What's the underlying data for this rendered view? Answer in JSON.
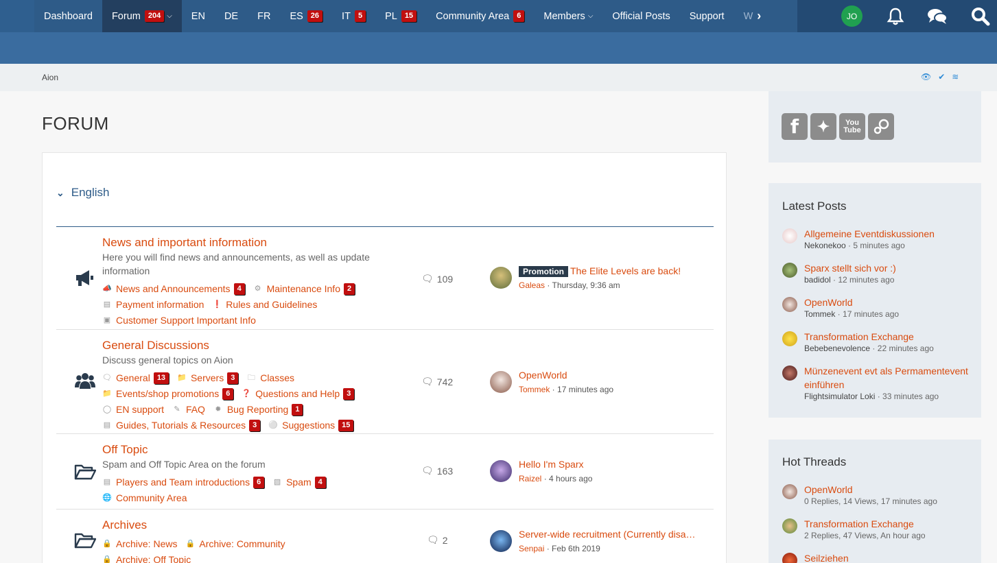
{
  "nav": {
    "items": [
      {
        "label": "Dashboard"
      },
      {
        "label": "Forum",
        "badge": "204"
      },
      {
        "label": "EN"
      },
      {
        "label": "DE"
      },
      {
        "label": "FR"
      },
      {
        "label": "ES",
        "badge": "26"
      },
      {
        "label": "IT",
        "badge": "5"
      },
      {
        "label": "PL",
        "badge": "15"
      },
      {
        "label": "Community Area",
        "badge": "6"
      },
      {
        "label": "Members"
      },
      {
        "label": "Official Posts"
      },
      {
        "label": "Support"
      },
      {
        "label": "W"
      }
    ],
    "user_initials": "JO",
    "icons": [
      "bell-icon",
      "chat-bubbles-icon",
      "search-icon"
    ]
  },
  "breadcrumb": {
    "item": "Aion"
  },
  "page": {
    "title": "FORUM"
  },
  "section": {
    "label": "English"
  },
  "boards": [
    {
      "title": "News and important information",
      "desc": "Here you will find news and announcements, as well as update information",
      "subs": [
        {
          "label": "News and Announcements",
          "badge": "4",
          "icon": "megaphone-icon"
        },
        {
          "label": "Maintenance Info",
          "badge": "2",
          "icon": "gears-icon"
        },
        {
          "label": "Payment information",
          "icon": "credit-card-icon"
        },
        {
          "label": "Rules and Guidelines",
          "icon": "exclamation-icon"
        },
        {
          "label": "Customer Support Important Info",
          "icon": "save-icon"
        }
      ],
      "count": "109",
      "last": {
        "prefix": "Promotion",
        "title": "The Elite Levels are back!",
        "user": "Galeas",
        "time": "Thursday, 9:36 am"
      }
    },
    {
      "title": "General Discussions",
      "desc": "Discuss general topics on Aion",
      "subs": [
        {
          "label": "General",
          "badge": "13",
          "icon": "comments-icon"
        },
        {
          "label": "Servers",
          "badge": "3",
          "icon": "folder-icon"
        },
        {
          "label": "Classes",
          "icon": "folder-open-icon"
        },
        {
          "label": "Events/shop promotions",
          "badge": "6",
          "icon": "folder-icon"
        },
        {
          "label": "Questions and Help",
          "badge": "3",
          "icon": "question-icon"
        },
        {
          "label": "EN support",
          "icon": "lifebuoy-icon"
        },
        {
          "label": "FAQ",
          "icon": "pencil-icon"
        },
        {
          "label": "Bug Reporting",
          "badge": "1",
          "icon": "bug-icon"
        },
        {
          "label": "Guides, Tutorials & Resources",
          "badge": "3",
          "icon": "book-icon"
        },
        {
          "label": "Suggestions",
          "badge": "15",
          "icon": "lightbulb-icon"
        }
      ],
      "count": "742",
      "last": {
        "title": "OpenWorld",
        "user": "Tommek",
        "time": "17 minutes ago"
      }
    },
    {
      "title": "Off Topic",
      "desc": "Spam and Off Topic Area on the forum",
      "subs": [
        {
          "label": "Players and Team introductions",
          "badge": "6",
          "icon": "id-card-icon"
        },
        {
          "label": "Spam",
          "badge": "4",
          "icon": "ticket-icon"
        },
        {
          "label": "Community Area",
          "icon": "globe-icon"
        }
      ],
      "count": "163",
      "last": {
        "title": "Hello I'm Sparx",
        "user": "Raizel",
        "time": "4 hours ago"
      }
    },
    {
      "title": "Archives",
      "desc": "",
      "subs": [
        {
          "label": "Archive: News",
          "icon": "lock-icon"
        },
        {
          "label": "Archive: Community",
          "icon": "lock-icon"
        },
        {
          "label": "Archive: Off Topic",
          "icon": "lock-icon"
        }
      ],
      "count": "2",
      "last": {
        "title": "Server-wide recruitment (Currently disa…",
        "user": "Senpai",
        "time": "Feb 6th 2019"
      }
    }
  ],
  "sidebar": {
    "social": [
      "facebook-icon",
      "twitter-icon",
      "youtube-icon",
      "steam-icon"
    ],
    "latest_posts": {
      "title": "Latest Posts",
      "items": [
        {
          "title": "Allgemeine Eventdiskussionen",
          "user": "Nekonekoo",
          "time": "5 minutes ago"
        },
        {
          "title": "Sparx stellt sich vor :)",
          "user": "badidol",
          "time": "12 minutes ago"
        },
        {
          "title": "OpenWorld",
          "user": "Tommek",
          "time": "17 minutes ago"
        },
        {
          "title": "Transformation Exchange",
          "user": "Bebebenevolence",
          "time": "22 minutes ago"
        },
        {
          "title": "Münzenevent evt als Permamentevent einführen",
          "user": "Flightsimulator Loki",
          "time": "33 minutes ago"
        }
      ]
    },
    "hot_threads": {
      "title": "Hot Threads",
      "items": [
        {
          "title": "OpenWorld",
          "meta": "0 Replies, 14 Views, 17 minutes ago"
        },
        {
          "title": "Transformation Exchange",
          "meta": "2 Replies, 47 Views, An hour ago"
        },
        {
          "title": "Seilziehen",
          "meta": ""
        }
      ]
    }
  },
  "colors": {
    "nav_bg": "#2e5b88",
    "active_nav": "#233f5f",
    "link": "#d94b0f",
    "badge": "#c10f0f",
    "sidebar_box": "#e7ecf1"
  }
}
